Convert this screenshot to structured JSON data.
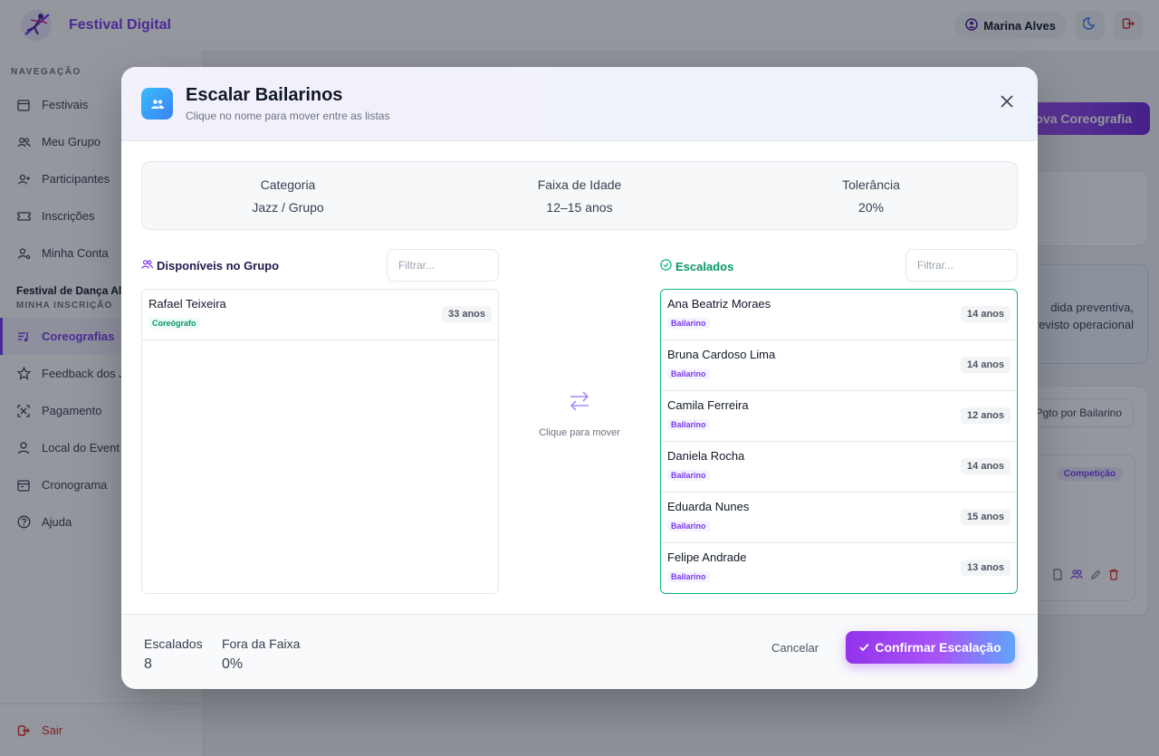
{
  "app": {
    "title": "Festival Digital",
    "user_name": "Marina Alves"
  },
  "sidebar": {
    "heading": "NAVEGAÇÃO",
    "items": [
      {
        "label": "Festivais",
        "icon": "calendar-icon"
      },
      {
        "label": "Meu Grupo",
        "icon": "users-icon"
      },
      {
        "label": "Participantes",
        "icon": "user-plus-icon"
      },
      {
        "label": "Inscrições",
        "icon": "ticket-icon"
      },
      {
        "label": "Minha Conta",
        "icon": "user-gear-icon"
      }
    ],
    "festival_name": "Festival de Dança Ali",
    "festival_subtitle": "MINHA INSCRIÇÃO",
    "festival_items": [
      {
        "label": "Coreografias",
        "icon": "music-list-icon",
        "active": true
      },
      {
        "label": "Feedback dos J",
        "icon": "star-icon"
      },
      {
        "label": "Pagamento",
        "icon": "qr-code-icon"
      },
      {
        "label": "Local do Event",
        "icon": "map-pin-icon"
      },
      {
        "label": "Cronograma",
        "icon": "calendar-icon"
      },
      {
        "label": "Ajuda",
        "icon": "help-icon"
      }
    ],
    "logout_label": "Sair"
  },
  "background": {
    "new_choreo_label": "ova Coreografia",
    "alert_line1": "dida preventiva,",
    "alert_line2": "revisto operacional",
    "pgto_label": "Pgto por Bailarino",
    "badge": "Competição"
  },
  "modal": {
    "title": "Escalar Bailarinos",
    "subtitle": "Clique no nome para mover entre as listas",
    "info": {
      "category_label": "Categoria",
      "category_value": "Jazz / Grupo",
      "age_label": "Faixa de Idade",
      "age_value": "12–15 anos",
      "tolerance_label": "Tolerância",
      "tolerance_value": "20%"
    },
    "available": {
      "title": "Disponíveis no Grupo",
      "filter_placeholder": "Filtrar...",
      "people": [
        {
          "name": "Rafael Teixeira",
          "role": "Coreógrafo",
          "age": "33 anos"
        }
      ]
    },
    "scaled": {
      "title": "Escalados",
      "filter_placeholder": "Filtrar...",
      "people": [
        {
          "name": "Ana Beatriz Moraes",
          "role": "Bailarino",
          "age": "14 anos"
        },
        {
          "name": "Bruna Cardoso Lima",
          "role": "Bailarino",
          "age": "14 anos"
        },
        {
          "name": "Camila Ferreira",
          "role": "Bailarino",
          "age": "12 anos"
        },
        {
          "name": "Daniela Rocha",
          "role": "Bailarino",
          "age": "14 anos"
        },
        {
          "name": "Eduarda Nunes",
          "role": "Bailarino",
          "age": "15 anos"
        },
        {
          "name": "Felipe Andrade",
          "role": "Bailarino",
          "age": "13 anos"
        }
      ]
    },
    "move_hint": "Clique para mover",
    "footer": {
      "scaled_label": "Escalados",
      "scaled_value": "8",
      "out_label": "Fora da Faixa",
      "out_value": "0%",
      "cancel_label": "Cancelar",
      "confirm_label": "Confirmar Escalação"
    }
  },
  "colors": {
    "accent": "#7c3aed",
    "success": "#10b981",
    "danger": "#dc2626"
  }
}
